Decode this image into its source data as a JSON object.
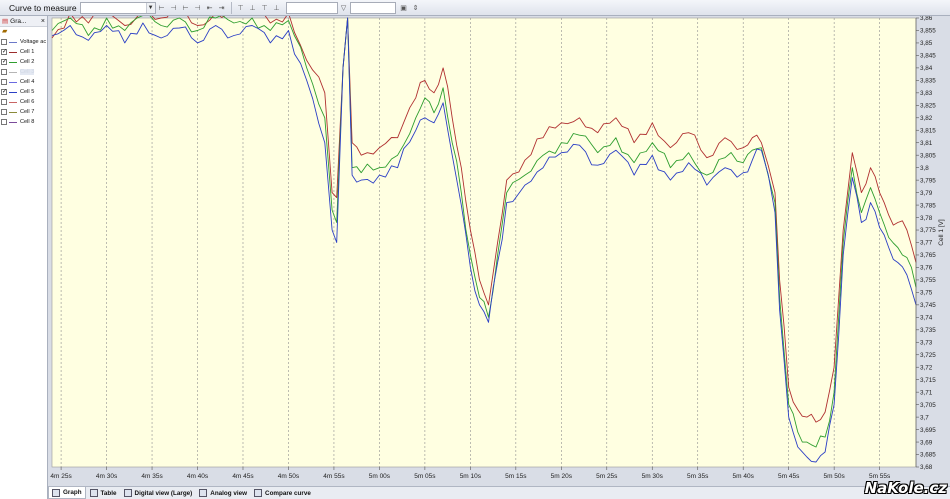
{
  "toolbar": {
    "curve_label": "Curve to measure",
    "curve_value": ""
  },
  "left_panel": {
    "title": "Gra...",
    "items": [
      {
        "label": "Voltage ac",
        "checked": false,
        "color": "#6b78c8"
      },
      {
        "label": "Cell 1",
        "checked": true,
        "color": "#9b2c2c"
      },
      {
        "label": "Cell 2",
        "checked": true,
        "color": "#2f9e2f"
      },
      {
        "label": "Cell 3",
        "checked": false,
        "color": "#b5b5b5",
        "selected": true
      },
      {
        "label": "Cell 4",
        "checked": false,
        "color": "#6a6ae0"
      },
      {
        "label": "Cell 5",
        "checked": true,
        "color": "#2b3fc5"
      },
      {
        "label": "Cell 6",
        "checked": false,
        "color": "#c86464"
      },
      {
        "label": "Cell 7",
        "checked": false,
        "color": "#8a8a3a"
      },
      {
        "label": "Cell 8",
        "checked": false,
        "color": "#7a4b9a"
      }
    ]
  },
  "tabs": [
    {
      "label": "Graph",
      "icon": "graph-icon",
      "active": true
    },
    {
      "label": "Table",
      "icon": "table-icon",
      "active": false
    },
    {
      "label": "Digital view (Large)",
      "icon": "digital-view-icon",
      "active": false
    },
    {
      "label": "Analog view",
      "icon": "analog-view-icon",
      "active": false
    },
    {
      "label": "Compare curve",
      "icon": "compare-curve-icon",
      "active": false
    }
  ],
  "watermark": "NaKole.cz",
  "chart_data": {
    "type": "line",
    "ylabel": "Cell 1 [V]",
    "ylim": [
      3.68,
      3.86
    ],
    "yticks": [
      "3,86",
      "3,855",
      "3,85",
      "3,845",
      "3,84",
      "3,835",
      "3,83",
      "3,825",
      "3,82",
      "3,815",
      "3,81",
      "3,805",
      "3,8",
      "3,795",
      "3,79",
      "3,785",
      "3,78",
      "3,775",
      "3,77",
      "3,765",
      "3,76",
      "3,755",
      "3,75",
      "3,745",
      "3,74",
      "3,735",
      "3,73",
      "3,725",
      "3,72",
      "3,715",
      "3,71",
      "3,705",
      "3,7",
      "3,695",
      "3,69",
      "3,685",
      "3,68"
    ],
    "xticks": [
      "4m 25s",
      "4m 30s",
      "4m 35s",
      "4m 40s",
      "4m 45s",
      "4m 50s",
      "4m 55s",
      "5m 00s",
      "5m 05s",
      "5m 10s",
      "5m 15s",
      "5m 20s",
      "5m 25s",
      "5m 30s",
      "5m 35s",
      "5m 40s",
      "5m 45s",
      "5m 50s",
      "5m 55s"
    ],
    "x_range_s": [
      264,
      359
    ],
    "grid": "vertical-dashed",
    "background": "#ffffe1",
    "series": [
      {
        "name": "Cell 1",
        "color": "#b03030",
        "points": [
          [
            264,
            3.852
          ],
          [
            266,
            3.862
          ],
          [
            268,
            3.858
          ],
          [
            270,
            3.862
          ],
          [
            272,
            3.857
          ],
          [
            274,
            3.863
          ],
          [
            276,
            3.86
          ],
          [
            278,
            3.862
          ],
          [
            280,
            3.857
          ],
          [
            282,
            3.862
          ],
          [
            284,
            3.861
          ],
          [
            286,
            3.863
          ],
          [
            288,
            3.858
          ],
          [
            290,
            3.862
          ],
          [
            292,
            3.843
          ],
          [
            294,
            3.83
          ],
          [
            294.8,
            3.79
          ],
          [
            295.3,
            3.788
          ],
          [
            296,
            3.84
          ],
          [
            296.5,
            3.86
          ],
          [
            297,
            3.81
          ],
          [
            298,
            3.805
          ],
          [
            300,
            3.808
          ],
          [
            302,
            3.812
          ],
          [
            304,
            3.828
          ],
          [
            305,
            3.835
          ],
          [
            306,
            3.83
          ],
          [
            307,
            3.84
          ],
          [
            308,
            3.82
          ],
          [
            309,
            3.8
          ],
          [
            310,
            3.775
          ],
          [
            311,
            3.755
          ],
          [
            312,
            3.745
          ],
          [
            313,
            3.77
          ],
          [
            314,
            3.795
          ],
          [
            316,
            3.803
          ],
          [
            318,
            3.812
          ],
          [
            320,
            3.818
          ],
          [
            322,
            3.82
          ],
          [
            324,
            3.814
          ],
          [
            326,
            3.82
          ],
          [
            328,
            3.81
          ],
          [
            330,
            3.818
          ],
          [
            332,
            3.808
          ],
          [
            334,
            3.814
          ],
          [
            336,
            3.804
          ],
          [
            338,
            3.812
          ],
          [
            340,
            3.808
          ],
          [
            341,
            3.812
          ],
          [
            342,
            3.81
          ],
          [
            343.5,
            3.79
          ],
          [
            344,
            3.755
          ],
          [
            345,
            3.712
          ],
          [
            346,
            3.703
          ],
          [
            347,
            3.7
          ],
          [
            348,
            3.698
          ],
          [
            349,
            3.702
          ],
          [
            350,
            3.72
          ],
          [
            351,
            3.775
          ],
          [
            352,
            3.806
          ],
          [
            353,
            3.79
          ],
          [
            354,
            3.8
          ],
          [
            355,
            3.79
          ],
          [
            356,
            3.781
          ],
          [
            357,
            3.778
          ],
          [
            358,
            3.775
          ],
          [
            359,
            3.762
          ]
        ]
      },
      {
        "name": "Cell 2",
        "color": "#2f9e2f",
        "points": [
          [
            264,
            3.855
          ],
          [
            266,
            3.86
          ],
          [
            268,
            3.853
          ],
          [
            270,
            3.86
          ],
          [
            272,
            3.855
          ],
          [
            274,
            3.861
          ],
          [
            276,
            3.857
          ],
          [
            278,
            3.86
          ],
          [
            280,
            3.855
          ],
          [
            282,
            3.86
          ],
          [
            284,
            3.858
          ],
          [
            286,
            3.86
          ],
          [
            288,
            3.855
          ],
          [
            290,
            3.859
          ],
          [
            292,
            3.84
          ],
          [
            294,
            3.82
          ],
          [
            294.8,
            3.783
          ],
          [
            295.3,
            3.778
          ],
          [
            296,
            3.84
          ],
          [
            296.5,
            3.86
          ],
          [
            297,
            3.8
          ],
          [
            298,
            3.798
          ],
          [
            300,
            3.8
          ],
          [
            302,
            3.805
          ],
          [
            304,
            3.82
          ],
          [
            305,
            3.828
          ],
          [
            306,
            3.822
          ],
          [
            307,
            3.832
          ],
          [
            308,
            3.81
          ],
          [
            309,
            3.79
          ],
          [
            310,
            3.765
          ],
          [
            311,
            3.748
          ],
          [
            312,
            3.74
          ],
          [
            313,
            3.765
          ],
          [
            314,
            3.79
          ],
          [
            316,
            3.797
          ],
          [
            318,
            3.805
          ],
          [
            320,
            3.81
          ],
          [
            322,
            3.813
          ],
          [
            324,
            3.806
          ],
          [
            326,
            3.812
          ],
          [
            328,
            3.802
          ],
          [
            330,
            3.81
          ],
          [
            332,
            3.8
          ],
          [
            334,
            3.806
          ],
          [
            336,
            3.797
          ],
          [
            338,
            3.804
          ],
          [
            340,
            3.802
          ],
          [
            341,
            3.807
          ],
          [
            342,
            3.808
          ],
          [
            343.5,
            3.786
          ],
          [
            344,
            3.748
          ],
          [
            345,
            3.705
          ],
          [
            346,
            3.694
          ],
          [
            347,
            3.69
          ],
          [
            348,
            3.688
          ],
          [
            349,
            3.692
          ],
          [
            350,
            3.71
          ],
          [
            351,
            3.77
          ],
          [
            352,
            3.8
          ],
          [
            353,
            3.782
          ],
          [
            354,
            3.792
          ],
          [
            355,
            3.782
          ],
          [
            356,
            3.772
          ],
          [
            357,
            3.768
          ],
          [
            358,
            3.764
          ],
          [
            359,
            3.752
          ]
        ]
      },
      {
        "name": "Cell 5",
        "color": "#2b3fc5",
        "points": [
          [
            264,
            3.853
          ],
          [
            266,
            3.857
          ],
          [
            268,
            3.851
          ],
          [
            270,
            3.857
          ],
          [
            272,
            3.85
          ],
          [
            274,
            3.858
          ],
          [
            276,
            3.852
          ],
          [
            278,
            3.856
          ],
          [
            280,
            3.85
          ],
          [
            282,
            3.857
          ],
          [
            284,
            3.853
          ],
          [
            286,
            3.857
          ],
          [
            288,
            3.85
          ],
          [
            290,
            3.855
          ],
          [
            292,
            3.835
          ],
          [
            294,
            3.81
          ],
          [
            294.8,
            3.775
          ],
          [
            295.3,
            3.77
          ],
          [
            296,
            3.84
          ],
          [
            296.5,
            3.86
          ],
          [
            297,
            3.797
          ],
          [
            298,
            3.795
          ],
          [
            300,
            3.797
          ],
          [
            302,
            3.8
          ],
          [
            304,
            3.815
          ],
          [
            305,
            3.82
          ],
          [
            306,
            3.818
          ],
          [
            307,
            3.826
          ],
          [
            308,
            3.805
          ],
          [
            309,
            3.785
          ],
          [
            310,
            3.76
          ],
          [
            311,
            3.745
          ],
          [
            312,
            3.738
          ],
          [
            313,
            3.762
          ],
          [
            314,
            3.786
          ],
          [
            316,
            3.793
          ],
          [
            318,
            3.8
          ],
          [
            320,
            3.806
          ],
          [
            322,
            3.809
          ],
          [
            324,
            3.801
          ],
          [
            326,
            3.807
          ],
          [
            328,
            3.797
          ],
          [
            330,
            3.805
          ],
          [
            332,
            3.795
          ],
          [
            334,
            3.802
          ],
          [
            336,
            3.793
          ],
          [
            338,
            3.8
          ],
          [
            340,
            3.798
          ],
          [
            341,
            3.803
          ],
          [
            342,
            3.807
          ],
          [
            343.5,
            3.782
          ],
          [
            344,
            3.743
          ],
          [
            345,
            3.7
          ],
          [
            346,
            3.688
          ],
          [
            347,
            3.684
          ],
          [
            348,
            3.682
          ],
          [
            349,
            3.686
          ],
          [
            350,
            3.705
          ],
          [
            351,
            3.765
          ],
          [
            352,
            3.796
          ],
          [
            353,
            3.778
          ],
          [
            354,
            3.786
          ],
          [
            355,
            3.776
          ],
          [
            356,
            3.768
          ],
          [
            357,
            3.762
          ],
          [
            358,
            3.757
          ],
          [
            359,
            3.745
          ]
        ]
      }
    ]
  }
}
